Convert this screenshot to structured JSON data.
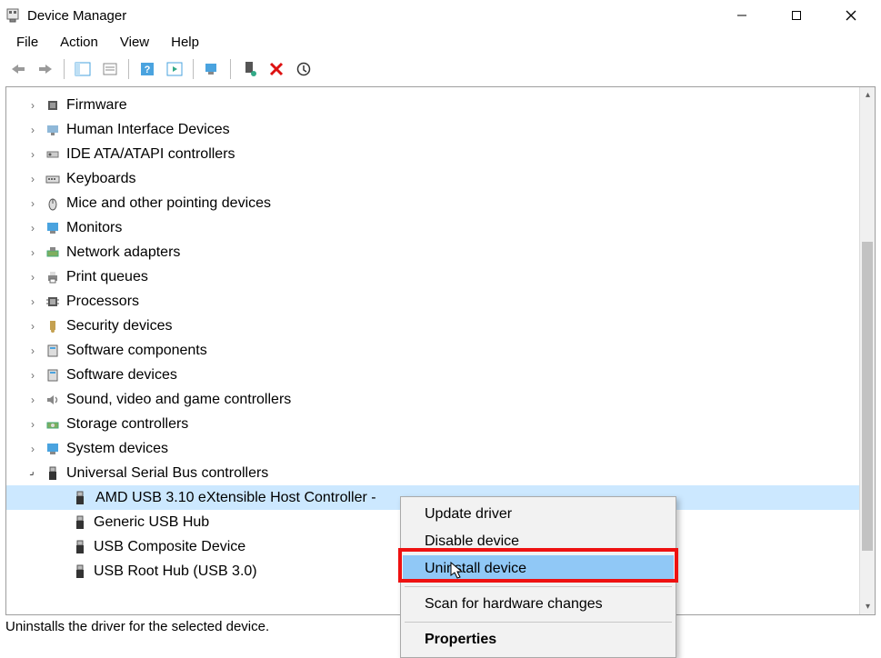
{
  "title": "Device Manager",
  "menus": {
    "file": "File",
    "action": "Action",
    "view": "View",
    "help": "Help"
  },
  "tree": {
    "items": [
      {
        "label": "Firmware",
        "expanded": false,
        "icon": "chip"
      },
      {
        "label": "Human Interface Devices",
        "expanded": false,
        "icon": "hid"
      },
      {
        "label": "IDE ATA/ATAPI controllers",
        "expanded": false,
        "icon": "ide"
      },
      {
        "label": "Keyboards",
        "expanded": false,
        "icon": "keyboard"
      },
      {
        "label": "Mice and other pointing devices",
        "expanded": false,
        "icon": "mouse"
      },
      {
        "label": "Monitors",
        "expanded": false,
        "icon": "monitor"
      },
      {
        "label": "Network adapters",
        "expanded": false,
        "icon": "network"
      },
      {
        "label": "Print queues",
        "expanded": false,
        "icon": "printer"
      },
      {
        "label": "Processors",
        "expanded": false,
        "icon": "cpu"
      },
      {
        "label": "Security devices",
        "expanded": false,
        "icon": "security"
      },
      {
        "label": "Software components",
        "expanded": false,
        "icon": "component"
      },
      {
        "label": "Software devices",
        "expanded": false,
        "icon": "component"
      },
      {
        "label": "Sound, video and game controllers",
        "expanded": false,
        "icon": "sound"
      },
      {
        "label": "Storage controllers",
        "expanded": false,
        "icon": "storage"
      },
      {
        "label": "System devices",
        "expanded": false,
        "icon": "system"
      },
      {
        "label": "Universal Serial Bus controllers",
        "expanded": true,
        "icon": "usb",
        "children": [
          {
            "label": "AMD USB 3.10 eXtensible Host Controller - ",
            "selected": true
          },
          {
            "label": "Generic USB Hub"
          },
          {
            "label": "USB Composite Device"
          },
          {
            "label": "USB Root Hub (USB 3.0)"
          }
        ]
      }
    ]
  },
  "context_menu": {
    "update": "Update driver",
    "disable": "Disable device",
    "uninstall": "Uninstall device",
    "scan": "Scan for hardware changes",
    "properties": "Properties"
  },
  "status_text": "Uninstalls the driver for the selected device."
}
